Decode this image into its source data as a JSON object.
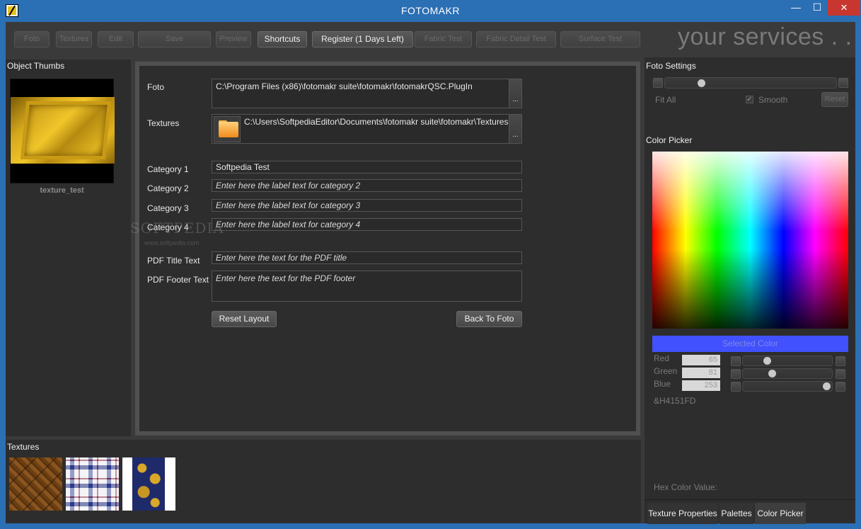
{
  "window": {
    "title": "FOTOMAKR",
    "min": "—",
    "max": "☐",
    "close": "✕"
  },
  "toolbar": {
    "buttons": [
      "Foto",
      "Textures",
      "Edit",
      "Save",
      "Preview",
      "Shortcuts",
      "Register (1 Days Left)",
      "Fabric Test",
      "Fabric Detail Test",
      "Surface Test"
    ],
    "brand": "your services . ."
  },
  "left_panel": {
    "label": "Object Thumbs",
    "thumb_caption": "texture_test"
  },
  "form": {
    "foto_label": "Foto",
    "foto_path": "C:\\Program Files (x86)\\fotomakr suite\\fotomakr\\fotomakrQSC.PlugIn",
    "textures_label": "Textures",
    "textures_path": "C:\\Users\\SoftpediaEditor\\Documents\\fotomakr suite\\fotomakr\\Textures",
    "browse": "...",
    "category1_label": "Category 1",
    "category1_value": "Softpedia Test",
    "category2_label": "Category 2",
    "category2_placeholder": "Enter here the label text for category 2",
    "category3_label": "Category 3",
    "category3_placeholder": "Enter here the label text for category 3",
    "category4_label": "Category 4",
    "category4_placeholder": "Enter here the label text for category 4",
    "pdf_title_label": "PDF Title Text",
    "pdf_title_placeholder": "Enter here the text for the PDF title",
    "pdf_footer_label": "PDF Footer Text",
    "pdf_footer_placeholder": "Enter here the text for  the PDF footer",
    "reset_layout": "Reset Layout",
    "back_to_foto": "Back To Foto"
  },
  "watermark": {
    "main": "SOFTPEDIA",
    "sub": "www.softpedia.com"
  },
  "textures_panel": {
    "label": "Textures"
  },
  "foto_settings": {
    "label": "Foto Settings",
    "fit_all": "Fit All",
    "smooth": "Smooth",
    "smooth_checked": true,
    "reset": "Reset",
    "zoom_fraction": 0.2
  },
  "color_picker": {
    "label": "Color Picker",
    "selected_label": "Selected Color",
    "selected_hex": "#4151FD",
    "red_label": "Red",
    "red_value": "65",
    "green_label": "Green",
    "green_value": "81",
    "blue_label": "Blue",
    "blue_value": "253",
    "hex_code": "&H4151FD",
    "hex_value_label": "Hex Color Value:"
  },
  "tabs": [
    "Texture Properties",
    "Palettes",
    "Color Picker"
  ],
  "active_tab": "Color Picker"
}
